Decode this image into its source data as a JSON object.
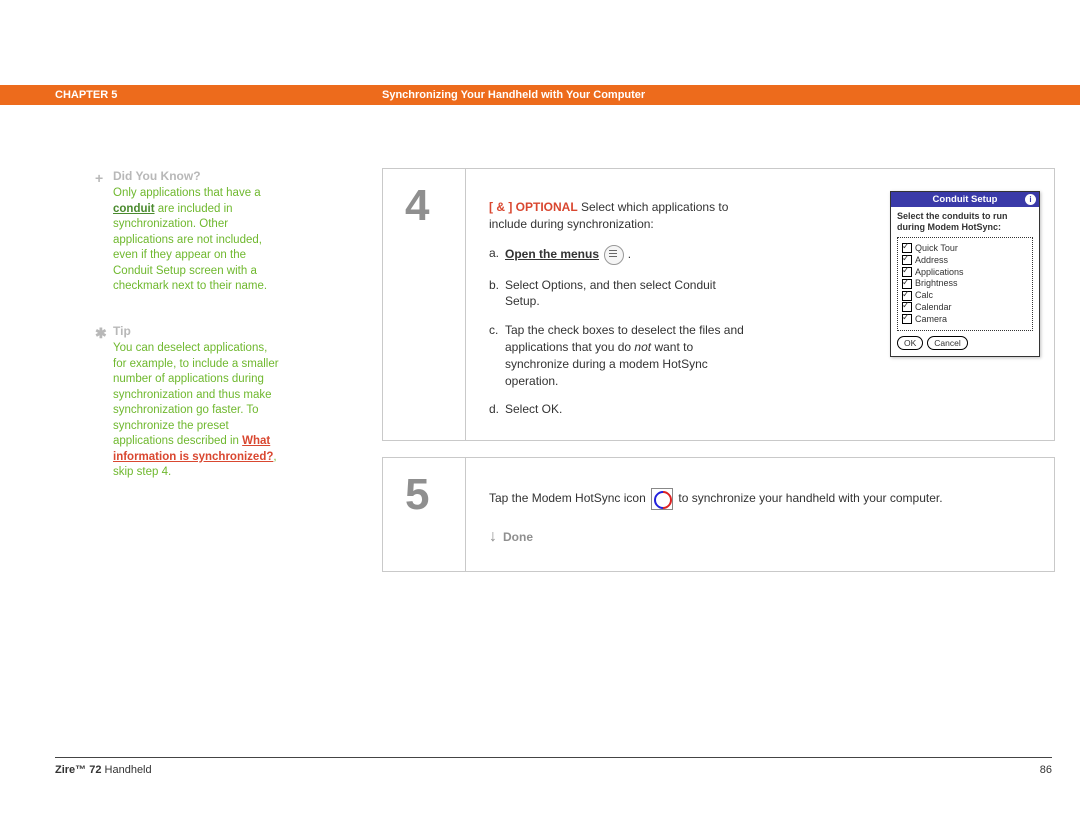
{
  "header": {
    "chapter": "CHAPTER 5",
    "title": "Synchronizing Your Handheld with Your Computer"
  },
  "sidebar": {
    "didyouknow": {
      "heading": "Did You Know?",
      "body_part1": "Only applications that have a ",
      "conduit": "conduit",
      "body_part2": " are included in synchronization. Other applications are not included, even if they appear on the Conduit Setup screen with a checkmark next to their name."
    },
    "tip": {
      "heading": "Tip",
      "body_part1": "You can deselect applications, for example, to include a smaller number of applications during synchronization and thus make synchronization go faster. To synchronize the preset applications described in ",
      "link": "What information is synchronized?",
      "body_part2": ", skip step 4."
    }
  },
  "steps": {
    "step4": {
      "num": "4",
      "optional_label": "[ & ]  OPTIONAL",
      "intro": "  Select which applications to include during synchronization:",
      "a_letter": "a.",
      "a_text": "Open the menus",
      "a_dot": " .",
      "b_letter": "b.",
      "b_text": "Select Options, and then select Conduit Setup.",
      "c_letter": "c.",
      "c_text_1": "Tap the check boxes to deselect the files and applications that you do ",
      "c_not": "not",
      "c_text_2": " want to synchronize during a modem HotSync operation.",
      "d_letter": "d.",
      "d_text": "Select OK."
    },
    "step5": {
      "num": "5",
      "text_before": "Tap the Modem HotSync icon ",
      "text_after": " to synchronize your handheld with your computer.",
      "done": "Done"
    }
  },
  "palm": {
    "title": "Conduit Setup",
    "info": "i",
    "instr": "Select the conduits to run during Modem HotSync:",
    "checks": [
      "Quick Tour",
      "Address",
      "Applications",
      "Brightness",
      "Calc",
      "Calendar",
      "Camera"
    ],
    "ok": "OK",
    "cancel": "Cancel"
  },
  "footer": {
    "zire_bold": "Zire™ 72",
    "zire_rest": " Handheld",
    "page": "86"
  }
}
